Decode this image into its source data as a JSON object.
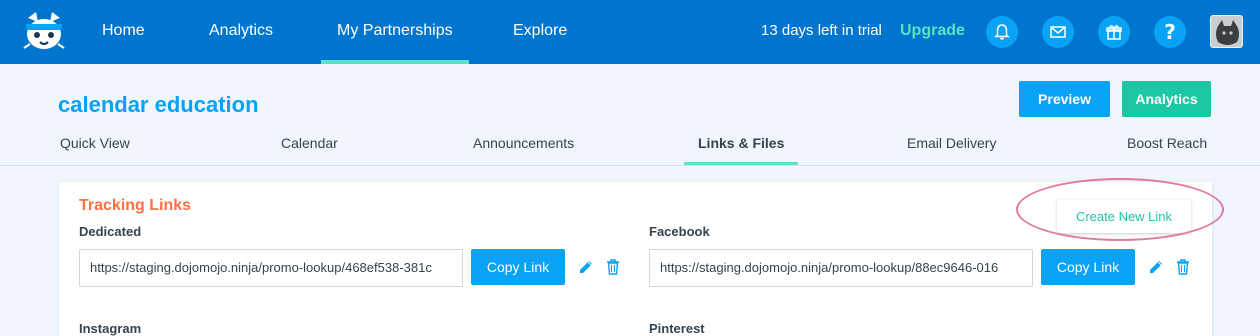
{
  "nav": {
    "items": [
      "Home",
      "Analytics",
      "My Partnerships",
      "Explore"
    ],
    "trial_text": "13 days left in trial",
    "upgrade_label": "Upgrade",
    "help_glyph": "?"
  },
  "header": {
    "title": "calendar education",
    "preview_label": "Preview",
    "analytics_label": "Analytics",
    "tabs": [
      "Quick View",
      "Calendar",
      "Announcements",
      "Links & Files",
      "Email Delivery",
      "Boost Reach"
    ],
    "active_tab": "Links & Files"
  },
  "tracking": {
    "section_title": "Tracking Links",
    "create_label": "Create New Link",
    "links": [
      {
        "label": "Dedicated",
        "url": "https://staging.dojomojo.ninja/promo-lookup/468ef538-381c",
        "copy_label": "Copy Link"
      },
      {
        "label": "Facebook",
        "url": "https://staging.dojomojo.ninja/promo-lookup/88ec9646-016",
        "copy_label": "Copy Link"
      }
    ],
    "more_labels": [
      "Instagram",
      "Pinterest"
    ]
  },
  "colors": {
    "nav_bg": "#0075cd",
    "accent_blue": "#0aa2f4",
    "accent_green": "#1dc7a4",
    "active_underline": "#5ee0c6",
    "section_orange": "#ff7043",
    "highlight_pink": "#e07aa3"
  },
  "icons": [
    "logo-icon",
    "bell-icon",
    "mail-icon",
    "gift-icon",
    "help-icon",
    "edit-icon",
    "trash-icon"
  ]
}
